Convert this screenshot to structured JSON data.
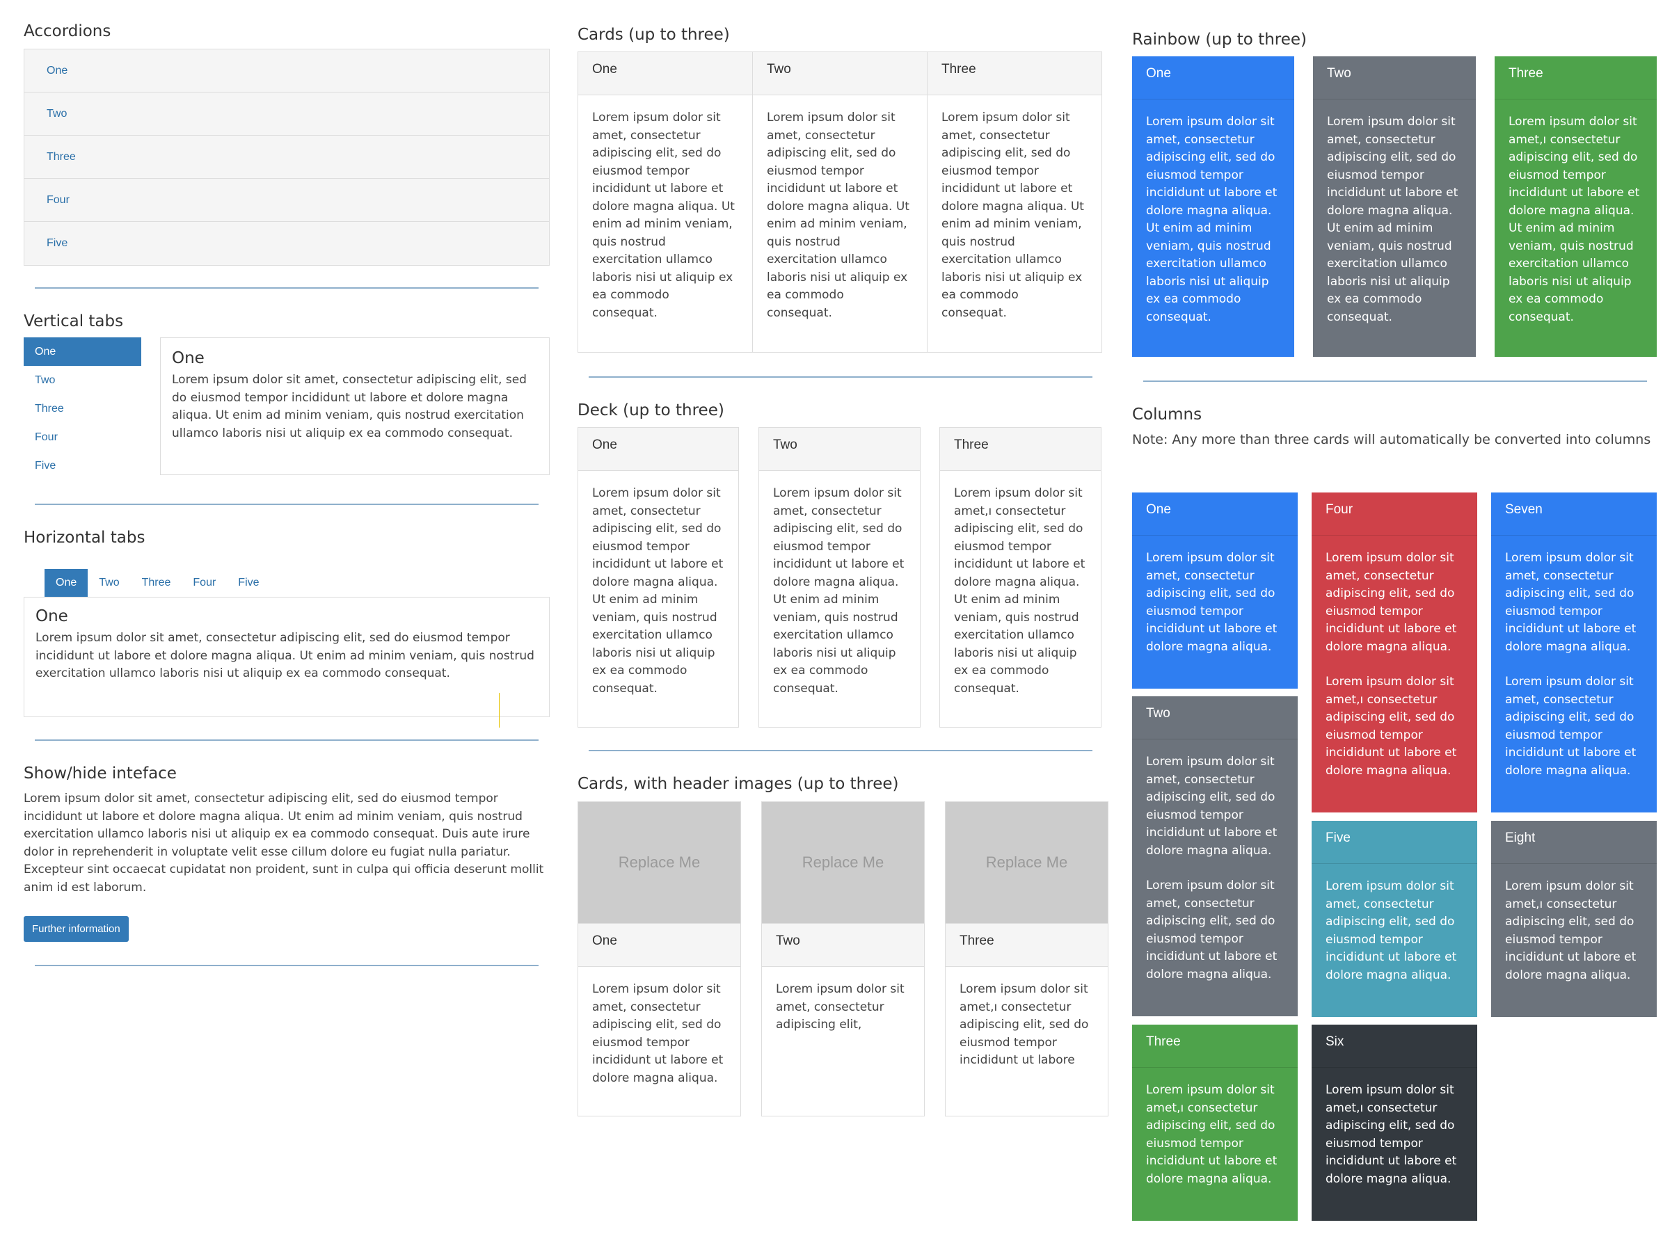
{
  "accordions": {
    "title": "Accordions",
    "items": [
      "One",
      "Two",
      "Three",
      "Four",
      "Five"
    ]
  },
  "vertical_tabs": {
    "title": "Vertical tabs",
    "tabs": [
      "One",
      "Two",
      "Three",
      "Four",
      "Five"
    ],
    "active_tab": "One",
    "pane_title": "One",
    "pane_text": "Lorem ipsum dolor sit amet, consectetur adipiscing elit, sed do eiusmod tempor incididunt ut labore et dolore magna aliqua. Ut enim ad minim veniam, quis nostrud exercitation ullamco laboris nisi ut aliquip ex ea commodo consequat."
  },
  "horizontal_tabs": {
    "title": "Horizontal tabs",
    "tabs": [
      "One",
      "Two",
      "Three",
      "Four",
      "Five"
    ],
    "active_tab": "One",
    "pane_title": "One",
    "pane_text": "Lorem ipsum dolor sit amet, consectetur adipiscing elit, sed do eiusmod tempor incididunt ut labore et dolore magna aliqua. Ut enim ad minim veniam, quis nostrud exercitation ullamco laboris nisi ut aliquip ex ea commodo consequat."
  },
  "show_hide": {
    "title": "Show/hide inteface",
    "text": "Lorem ipsum dolor sit amet, consectetur adipiscing elit, sed do eiusmod tempor incididunt ut labore et dolore magna aliqua. Ut enim ad minim veniam, quis nostrud exercitation ullamco laboris nisi ut aliquip ex ea commodo consequat. Duis aute irure dolor in reprehenderit in voluptate velit esse cillum dolore eu fugiat nulla pariatur. Excepteur sint occaecat cupidatat non proident, sunt in culpa qui officia deserunt mollit anim id est laborum.",
    "button_label": "Further information"
  },
  "cards": {
    "title": "Cards (up to three)",
    "items": [
      {
        "title": "One",
        "text": "Lorem ipsum dolor sit amet, consectetur adipiscing elit, sed do eiusmod tempor incididunt ut labore et dolore magna aliqua. Ut enim ad minim veniam, quis nostrud exercitation ullamco laboris nisi ut aliquip ex ea commodo consequat."
      },
      {
        "title": "Two",
        "text": "Lorem ipsum dolor sit amet, consectetur adipiscing elit, sed do eiusmod tempor incididunt ut labore et dolore magna aliqua. Ut enim ad minim veniam, quis nostrud exercitation ullamco laboris nisi ut aliquip ex ea commodo consequat."
      },
      {
        "title": "Three",
        "text": "Lorem ipsum dolor sit amet, consectetur adipiscing elit, sed do eiusmod tempor incididunt ut labore et dolore magna aliqua. Ut enim ad minim veniam, quis nostrud exercitation ullamco laboris nisi ut aliquip ex ea commodo consequat."
      }
    ]
  },
  "deck": {
    "title": "Deck (up to three)",
    "items": [
      {
        "title": "One",
        "text": "Lorem ipsum dolor sit amet, consectetur adipiscing elit, sed do eiusmod tempor incididunt ut labore et dolore magna aliqua. Ut enim ad minim veniam, quis nostrud exercitation ullamco laboris nisi ut aliquip ex ea commodo consequat."
      },
      {
        "title": "Two",
        "text": "Lorem ipsum dolor sit amet, consectetur adipiscing elit, sed do eiusmod tempor incididunt ut labore et dolore magna aliqua. Ut enim ad minim veniam, quis nostrud exercitation ullamco laboris nisi ut aliquip ex ea commodo consequat."
      },
      {
        "title": "Three",
        "text": "Lorem ipsum dolor sit amet,ı consectetur adipiscing elit, sed do eiusmod tempor incididunt ut labore et dolore magna aliqua. Ut enim ad minim veniam, quis nostrud exercitation ullamco laboris nisi ut aliquip ex ea commodo consequat."
      }
    ]
  },
  "image_cards": {
    "title": "Cards, with header images (up to three)",
    "placeholder": "Replace Me",
    "items": [
      {
        "title": "One",
        "text": "Lorem ipsum dolor sit amet, consectetur adipiscing elit, sed do eiusmod tempor incididunt ut labore et dolore magna aliqua."
      },
      {
        "title": "Two",
        "text": "Lorem ipsum dolor sit amet, consectetur adipiscing elit,"
      },
      {
        "title": "Three",
        "text": "Lorem ipsum dolor sit amet,ı consectetur adipiscing elit, sed do eiusmod tempor incididunt ut labore"
      }
    ]
  },
  "rainbow": {
    "title": "Rainbow (up to three)",
    "items": [
      {
        "title": "One",
        "text": "Lorem ipsum dolor sit amet, consectetur adipiscing elit, sed do eiusmod tempor incididunt ut labore et dolore magna aliqua. Ut enim ad minim veniam, quis nostrud exercitation ullamco laboris nisi ut aliquip ex ea commodo consequat."
      },
      {
        "title": "Two",
        "text": "Lorem ipsum dolor sit amet, consectetur adipiscing elit, sed do eiusmod tempor incididunt ut labore et dolore magna aliqua. Ut enim ad minim veniam, quis nostrud exercitation ullamco laboris nisi ut aliquip ex ea commodo consequat."
      },
      {
        "title": "Three",
        "text": "Lorem ipsum dolor sit amet,ı consectetur adipiscing elit, sed do eiusmod tempor incididunt ut labore et dolore magna aliqua. Ut enim ad minim veniam, quis nostrud exercitation ullamco laboris nisi ut aliquip ex ea commodo consequat."
      }
    ]
  },
  "columns": {
    "title": "Columns",
    "note": "Note: Any more than three cards will automatically be converted into columns",
    "short_text": "Lorem ipsum dolor sit amet, consectetur adipiscing elit, sed do eiusmod tempor incididunt ut labore et dolore magna aliqua.",
    "short_text_alt": "Lorem ipsum dolor sit amet,ı consectetur adipiscing elit, sed do eiusmod tempor incididunt ut labore et dolore magna aliqua.",
    "cards": {
      "one": "One",
      "two": "Two",
      "three": "Three",
      "four": "Four",
      "five": "Five",
      "six": "Six",
      "seven": "Seven",
      "eight": "Eight"
    }
  },
  "colors": {
    "blue": "#2f7ef1",
    "grey": "#6c737c",
    "green": "#4ea34b",
    "red": "#cf4149",
    "teal": "#4ba2b8",
    "dark": "#33393f",
    "link": "#2a6fa8",
    "active_tab": "#337ab7"
  }
}
